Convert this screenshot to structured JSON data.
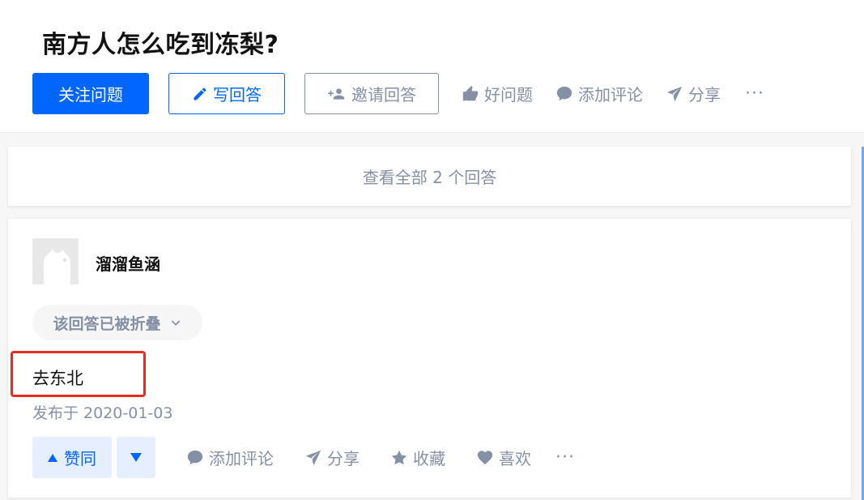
{
  "question": {
    "title": "南方人怎么吃到冻梨?",
    "actions": {
      "follow": "关注问题",
      "write": "写回答",
      "invite": "邀请回答",
      "good_question": "好问题",
      "comment": "添加评论",
      "share": "分享",
      "more": "···"
    }
  },
  "view_all": "查看全部 2 个回答",
  "answer": {
    "author": "溜溜鱼涵",
    "collapsed_notice": "该回答已被折叠",
    "content": "去东北",
    "published": "发布于 2020-01-03",
    "actions": {
      "upvote": "赞同",
      "comment": "添加评论",
      "share": "分享",
      "collect": "收藏",
      "like": "喜欢",
      "more": "···"
    }
  },
  "colors": {
    "primary": "#0066ff",
    "muted": "#8590a6",
    "highlight": "#e52b22"
  }
}
